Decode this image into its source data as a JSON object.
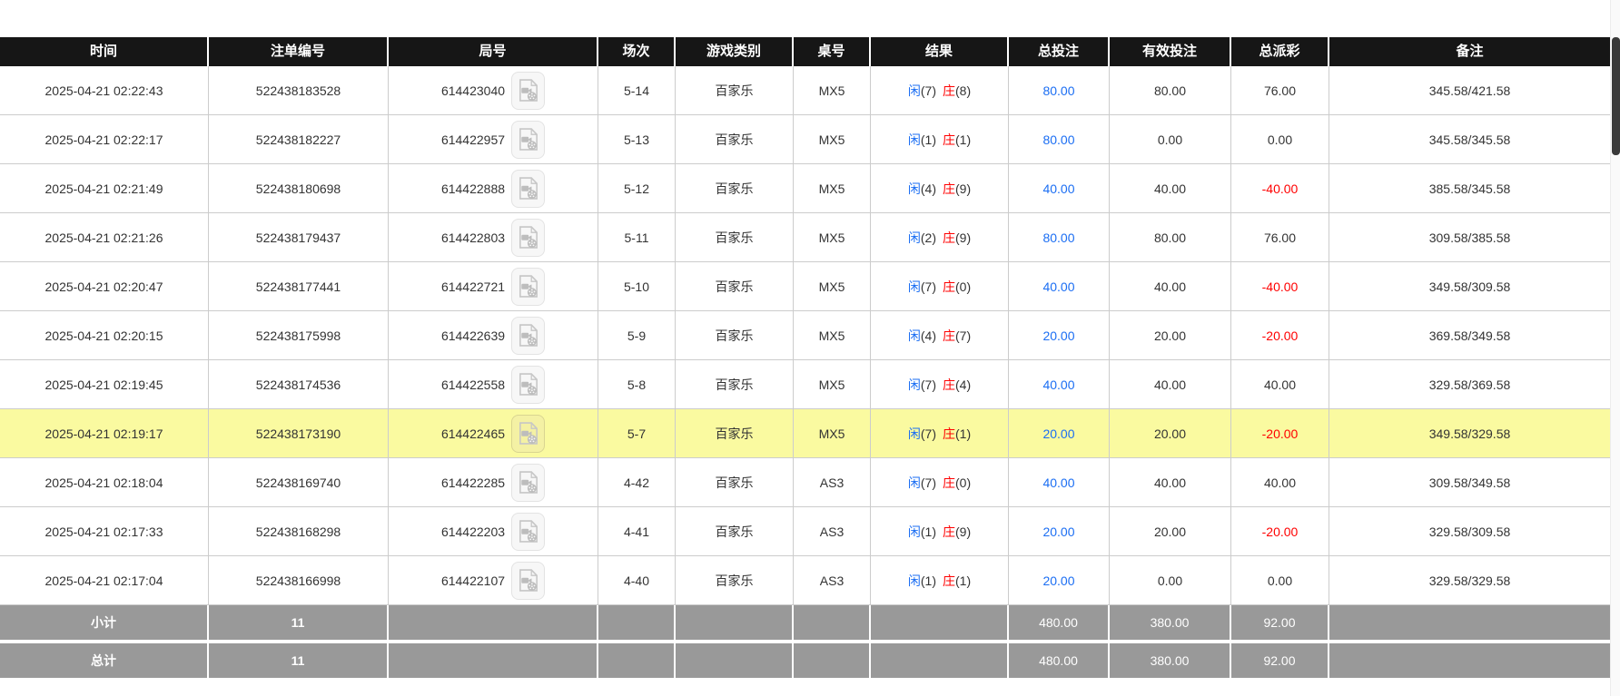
{
  "columns": [
    "时间",
    "注单编号",
    "局号",
    "场次",
    "游戏类别",
    "桌号",
    "结果",
    "总投注",
    "有效投注",
    "总派彩",
    "备注"
  ],
  "rows": [
    {
      "time": "2025-04-21 02:22:43",
      "bet_no": "522438183528",
      "round_no": "614423040",
      "session": "5-14",
      "game": "百家乐",
      "table": "MX5",
      "result": {
        "player_label": "闲",
        "player_score": "(7)",
        "banker_label": "庄",
        "banker_score": "(8)"
      },
      "total_bet": "80.00",
      "valid_bet": "80.00",
      "payout": "76.00",
      "remark": "345.58/421.58",
      "highlight": false
    },
    {
      "time": "2025-04-21 02:22:17",
      "bet_no": "522438182227",
      "round_no": "614422957",
      "session": "5-13",
      "game": "百家乐",
      "table": "MX5",
      "result": {
        "player_label": "闲",
        "player_score": "(1)",
        "banker_label": "庄",
        "banker_score": "(1)"
      },
      "total_bet": "80.00",
      "valid_bet": "0.00",
      "payout": "0.00",
      "remark": "345.58/345.58",
      "highlight": false
    },
    {
      "time": "2025-04-21 02:21:49",
      "bet_no": "522438180698",
      "round_no": "614422888",
      "session": "5-12",
      "game": "百家乐",
      "table": "MX5",
      "result": {
        "player_label": "闲",
        "player_score": "(4)",
        "banker_label": "庄",
        "banker_score": "(9)"
      },
      "total_bet": "40.00",
      "valid_bet": "40.00",
      "payout": "-40.00",
      "remark": "385.58/345.58",
      "highlight": false
    },
    {
      "time": "2025-04-21 02:21:26",
      "bet_no": "522438179437",
      "round_no": "614422803",
      "session": "5-11",
      "game": "百家乐",
      "table": "MX5",
      "result": {
        "player_label": "闲",
        "player_score": "(2)",
        "banker_label": "庄",
        "banker_score": "(9)"
      },
      "total_bet": "80.00",
      "valid_bet": "80.00",
      "payout": "76.00",
      "remark": "309.58/385.58",
      "highlight": false
    },
    {
      "time": "2025-04-21 02:20:47",
      "bet_no": "522438177441",
      "round_no": "614422721",
      "session": "5-10",
      "game": "百家乐",
      "table": "MX5",
      "result": {
        "player_label": "闲",
        "player_score": "(7)",
        "banker_label": "庄",
        "banker_score": "(0)"
      },
      "total_bet": "40.00",
      "valid_bet": "40.00",
      "payout": "-40.00",
      "remark": "349.58/309.58",
      "highlight": false
    },
    {
      "time": "2025-04-21 02:20:15",
      "bet_no": "522438175998",
      "round_no": "614422639",
      "session": "5-9",
      "game": "百家乐",
      "table": "MX5",
      "result": {
        "player_label": "闲",
        "player_score": "(4)",
        "banker_label": "庄",
        "banker_score": "(7)"
      },
      "total_bet": "20.00",
      "valid_bet": "20.00",
      "payout": "-20.00",
      "remark": "369.58/349.58",
      "highlight": false
    },
    {
      "time": "2025-04-21 02:19:45",
      "bet_no": "522438174536",
      "round_no": "614422558",
      "session": "5-8",
      "game": "百家乐",
      "table": "MX5",
      "result": {
        "player_label": "闲",
        "player_score": "(7)",
        "banker_label": "庄",
        "banker_score": "(4)"
      },
      "total_bet": "40.00",
      "valid_bet": "40.00",
      "payout": "40.00",
      "remark": "329.58/369.58",
      "highlight": false
    },
    {
      "time": "2025-04-21 02:19:17",
      "bet_no": "522438173190",
      "round_no": "614422465",
      "session": "5-7",
      "game": "百家乐",
      "table": "MX5",
      "result": {
        "player_label": "闲",
        "player_score": "(7)",
        "banker_label": "庄",
        "banker_score": "(1)"
      },
      "total_bet": "20.00",
      "valid_bet": "20.00",
      "payout": "-20.00",
      "remark": "349.58/329.58",
      "highlight": true
    },
    {
      "time": "2025-04-21 02:18:04",
      "bet_no": "522438169740",
      "round_no": "614422285",
      "session": "4-42",
      "game": "百家乐",
      "table": "AS3",
      "result": {
        "player_label": "闲",
        "player_score": "(7)",
        "banker_label": "庄",
        "banker_score": "(0)"
      },
      "total_bet": "40.00",
      "valid_bet": "40.00",
      "payout": "40.00",
      "remark": "309.58/349.58",
      "highlight": false
    },
    {
      "time": "2025-04-21 02:17:33",
      "bet_no": "522438168298",
      "round_no": "614422203",
      "session": "4-41",
      "game": "百家乐",
      "table": "AS3",
      "result": {
        "player_label": "闲",
        "player_score": "(1)",
        "banker_label": "庄",
        "banker_score": "(9)"
      },
      "total_bet": "20.00",
      "valid_bet": "20.00",
      "payout": "-20.00",
      "remark": "329.58/309.58",
      "highlight": false
    },
    {
      "time": "2025-04-21 02:17:04",
      "bet_no": "522438166998",
      "round_no": "614422107",
      "session": "4-40",
      "game": "百家乐",
      "table": "AS3",
      "result": {
        "player_label": "闲",
        "player_score": "(1)",
        "banker_label": "庄",
        "banker_score": "(1)"
      },
      "total_bet": "20.00",
      "valid_bet": "0.00",
      "payout": "0.00",
      "remark": "329.58/329.58",
      "highlight": false
    }
  ],
  "footer": {
    "subtotal": {
      "label": "小计",
      "count": "11",
      "total_bet": "480.00",
      "valid_bet": "380.00",
      "payout": "92.00"
    },
    "total": {
      "label": "总计",
      "count": "11",
      "total_bet": "480.00",
      "valid_bet": "380.00",
      "payout": "92.00"
    }
  },
  "icons": {
    "round_video": "video-file-icon"
  },
  "colors": {
    "header_bg": "#161616",
    "footer_bg": "#999999",
    "highlight_row": "#fafaa0",
    "bet_blue": "#1b6ef3",
    "loss_red": "#ff0000",
    "grid_border": "#cccccc",
    "text": "#333333"
  }
}
